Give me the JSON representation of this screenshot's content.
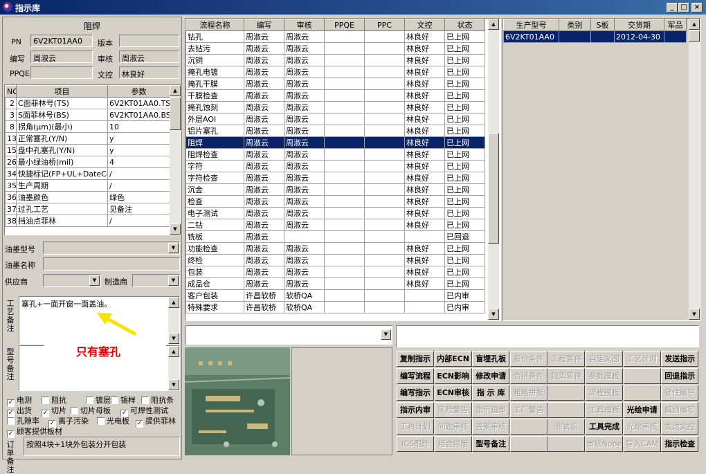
{
  "window": {
    "title": "指示库",
    "min": "_",
    "max": "□",
    "close": "×"
  },
  "left": {
    "process_title": "阻焊",
    "pn_label": "PN",
    "pn": "6V2KT01AA0",
    "version_label": "版本",
    "version": "",
    "writer_label": "编写",
    "writer": "周淑云",
    "reviewer_label": "审核",
    "reviewer": "周淑云",
    "ppqe_label": "PPQE",
    "ppqe": "",
    "doc_label": "文控",
    "doc": "林良好",
    "param_headers": [
      "NO",
      "项目",
      "参数"
    ],
    "params": [
      [
        "2",
        "C面菲林号(TS)",
        "6V2KT01AA0.TS"
      ],
      [
        "3",
        "S面菲林号(BS)",
        "6V2KT01AA0.BS"
      ],
      [
        "8",
        "拐角(μm)(最小)",
        "10"
      ],
      [
        "13",
        "正常塞孔(Y/N)",
        "y"
      ],
      [
        "15",
        "盘中孔塞孔(Y/N)",
        "y"
      ],
      [
        "26",
        "最小绿油桥(mil)",
        "4"
      ],
      [
        "34",
        "快捷标记(FP+UL+DateCo",
        "/"
      ],
      [
        "35",
        "生产周期",
        "/"
      ],
      [
        "36",
        "油墨颜色",
        "绿色"
      ],
      [
        "37",
        "过孔工艺",
        "见备注"
      ],
      [
        "38",
        "挡油点菲林",
        "/"
      ]
    ],
    "ink_model_label": "油墨型号",
    "ink_model": "",
    "ink_name_label": "油墨名称",
    "ink_name": "",
    "supplier_label": "供应商",
    "supplier": "",
    "maker_label": "制造商",
    "maker": "",
    "process_note_label": "工艺备注",
    "process_note": "塞孔+一面开窗一面盖油。",
    "model_note_label": "型号备注",
    "callout": "只有塞孔",
    "checks": [
      {
        "label": "电测",
        "checked": true
      },
      {
        "label": "阻抗",
        "checked": false
      },
      {
        "label": "镀层",
        "checked": false
      },
      {
        "label": "锡样",
        "checked": false
      },
      {
        "label": "阻抗条",
        "checked": false
      },
      {
        "label": "出货",
        "checked": true
      },
      {
        "label": "切片",
        "checked": true
      },
      {
        "label": "切片母板",
        "checked": false
      },
      {
        "label": "可焊性测试",
        "checked": true
      },
      {
        "label": "孔隙率",
        "checked": false
      },
      {
        "label": "离子污染",
        "checked": true
      },
      {
        "label": "光电板",
        "checked": false
      },
      {
        "label": "提供菲林",
        "checked": true
      },
      {
        "label": "顾客提供板材",
        "checked": true
      }
    ],
    "order_note_label": "订单备注",
    "order_note": "按照4块+1块外包装分开包装"
  },
  "process_table": {
    "headers": [
      "流程名称",
      "编写",
      "审核",
      "PPQE",
      "PPC",
      "文控",
      "状态"
    ],
    "rows": [
      [
        "钻孔",
        "周淑云",
        "周淑云",
        "",
        "",
        "林良好",
        "已上网"
      ],
      [
        "去钻污",
        "周淑云",
        "周淑云",
        "",
        "",
        "林良好",
        "已上网"
      ],
      [
        "沉铜",
        "周淑云",
        "周淑云",
        "",
        "",
        "林良好",
        "已上网"
      ],
      [
        "掩孔电镀",
        "周淑云",
        "周淑云",
        "",
        "",
        "林良好",
        "已上网"
      ],
      [
        "掩孔干膜",
        "周淑云",
        "周淑云",
        "",
        "",
        "林良好",
        "已上网"
      ],
      [
        "干膜检查",
        "周淑云",
        "周淑云",
        "",
        "",
        "林良好",
        "已上网"
      ],
      [
        "掩孔蚀刻",
        "周淑云",
        "周淑云",
        "",
        "",
        "林良好",
        "已上网"
      ],
      [
        "外层AOI",
        "周淑云",
        "周淑云",
        "",
        "",
        "林良好",
        "已上网"
      ],
      [
        "铝片塞孔",
        "周淑云",
        "周淑云",
        "",
        "",
        "林良好",
        "已上网"
      ],
      [
        "阻焊",
        "周淑云",
        "周淑云",
        "",
        "",
        "林良好",
        "已上网"
      ],
      [
        "阻焊检查",
        "周淑云",
        "周淑云",
        "",
        "",
        "林良好",
        "已上网"
      ],
      [
        "字符",
        "周淑云",
        "周淑云",
        "",
        "",
        "林良好",
        "已上网"
      ],
      [
        "字符检查",
        "周淑云",
        "周淑云",
        "",
        "",
        "林良好",
        "已上网"
      ],
      [
        "沉金",
        "周淑云",
        "周淑云",
        "",
        "",
        "林良好",
        "已上网"
      ],
      [
        "检查",
        "周淑云",
        "周淑云",
        "",
        "",
        "林良好",
        "已上网"
      ],
      [
        "电子测试",
        "周淑云",
        "周淑云",
        "",
        "",
        "林良好",
        "已上网"
      ],
      [
        "二钻",
        "周淑云",
        "周淑云",
        "",
        "",
        "林良好",
        "已上网"
      ],
      [
        "铣板",
        "周淑云",
        "",
        "",
        "",
        "",
        "已回退"
      ],
      [
        "功能检查",
        "周淑云",
        "周淑云",
        "",
        "",
        "林良好",
        "已上网"
      ],
      [
        "终检",
        "周淑云",
        "周淑云",
        "",
        "",
        "林良好",
        "已上网"
      ],
      [
        "包装",
        "周淑云",
        "周淑云",
        "",
        "",
        "林良好",
        "已上网"
      ],
      [
        "成品仓",
        "周淑云",
        "周淑云",
        "",
        "",
        "林良好",
        "已上网"
      ],
      [
        "客户包装",
        "许昌软桥",
        "软桥QA",
        "",
        "",
        "",
        "已内审"
      ],
      [
        "特殊要求",
        "许昌软桥",
        "软桥QA",
        "",
        "",
        "",
        "已内审"
      ]
    ],
    "selected_index": 9
  },
  "product_table": {
    "headers": [
      "生产型号",
      "类别",
      "S板",
      "交货期",
      "军品"
    ],
    "rows": [
      [
        "6V2KT01AA0",
        "",
        "",
        "2012-04-30",
        ""
      ]
    ]
  },
  "buttons": [
    [
      "复制指示",
      "内部ECN",
      "盲埋孔板",
      "报价条件",
      "工程暂停",
      "自定义图",
      "工艺计时",
      "发送指示"
    ],
    [
      "编写流程",
      "ECN影响",
      "修改申请",
      "合拼条件",
      "取消暂停",
      "参数模板",
      "",
      "回退指示"
    ],
    [
      "编写指示",
      "ECN审核",
      "指 示 库",
      "粗略拼板",
      "",
      "流程模板",
      "",
      "锁住编写"
    ],
    [
      "指示内审",
      "风险警告",
      "指示退审",
      "工厂警告",
      "",
      "工具模板",
      "光绘申请",
      "解锁编写"
    ],
    [
      "工具计划",
      "问题审核",
      "答案审核",
      "",
      "测试点",
      "工具完成",
      "光绘审核",
      "发送文控"
    ],
    [
      "ICS跟踪",
      "组合排版",
      "型号备注",
      "",
      "",
      "审核Nope",
      "导入CAM",
      "指示检查"
    ]
  ],
  "buttons_disabled": [
    [
      false,
      false,
      false,
      true,
      true,
      true,
      true,
      false
    ],
    [
      false,
      false,
      false,
      true,
      true,
      true,
      false,
      false
    ],
    [
      false,
      false,
      false,
      true,
      false,
      true,
      false,
      true
    ],
    [
      false,
      true,
      true,
      true,
      false,
      true,
      false,
      true
    ],
    [
      true,
      true,
      true,
      false,
      true,
      false,
      true,
      true
    ],
    [
      true,
      true,
      false,
      false,
      false,
      true,
      true,
      false
    ]
  ]
}
